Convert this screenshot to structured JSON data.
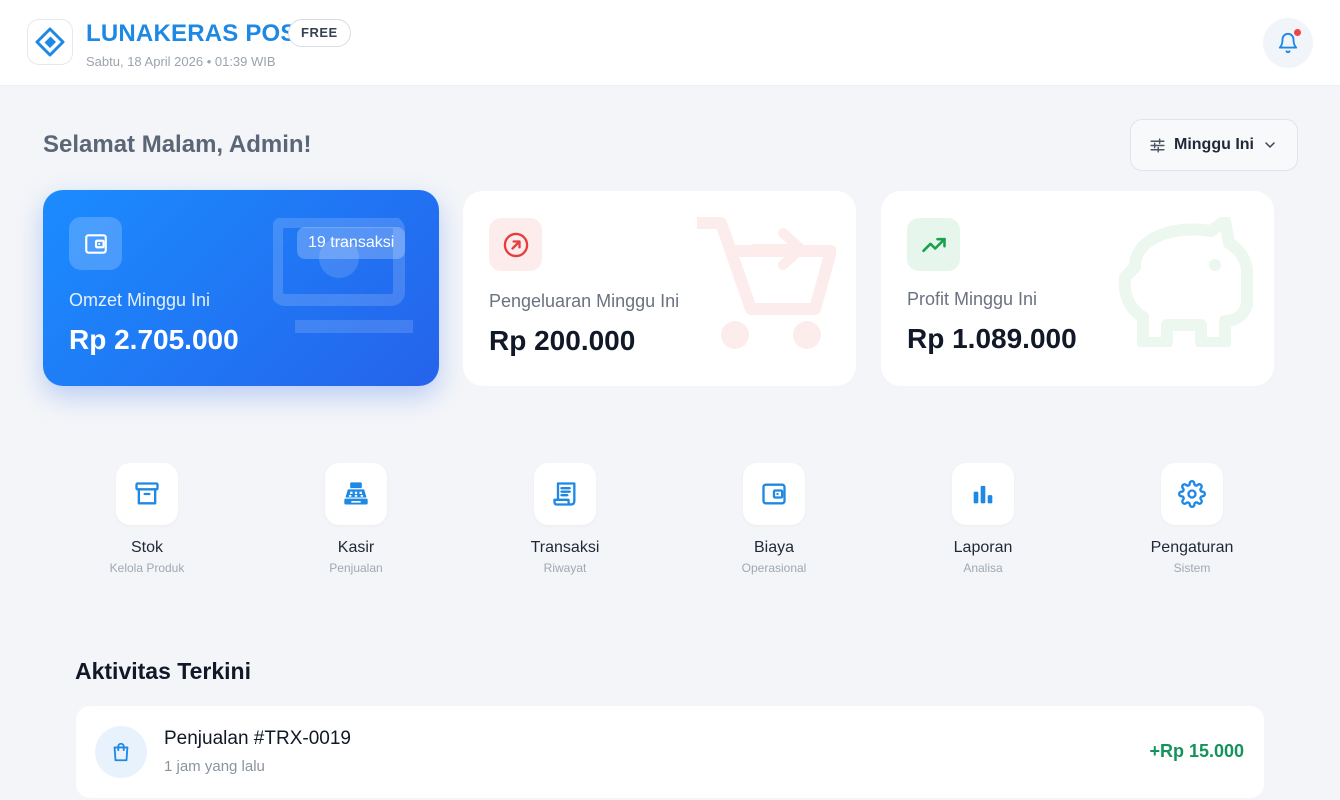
{
  "header": {
    "brand": "LUNAKERAS POS",
    "plan": "FREE",
    "datetime": "Sabtu, 18 April 2026 • 01:39 WIB"
  },
  "greeting": "Selamat Malam, Admin!",
  "period_filter": {
    "label": "Minggu Ini"
  },
  "stats": {
    "omzet": {
      "label": "Omzet Minggu Ini",
      "value": "Rp 2.705.000",
      "badge": "19 transaksi",
      "icon": "wallet-icon"
    },
    "pengeluaran": {
      "label": "Pengeluaran Minggu Ini",
      "value": "Rp 200.000",
      "icon": "arrow-up-right-circle-icon"
    },
    "profit": {
      "label": "Profit Minggu Ini",
      "value": "Rp 1.089.000",
      "icon": "trending-up-icon"
    }
  },
  "menu": [
    {
      "label": "Stok",
      "sub": "Kelola Produk",
      "icon": "archive-box-icon"
    },
    {
      "label": "Kasir",
      "sub": "Penjualan",
      "icon": "cash-register-icon"
    },
    {
      "label": "Transaksi",
      "sub": "Riwayat",
      "icon": "receipt-icon"
    },
    {
      "label": "Biaya",
      "sub": "Operasional",
      "icon": "wallet-icon"
    },
    {
      "label": "Laporan",
      "sub": "Analisa",
      "icon": "bar-chart-icon"
    },
    {
      "label": "Pengaturan",
      "sub": "Sistem",
      "icon": "gear-icon"
    }
  ],
  "activity": {
    "title": "Aktivitas Terkini",
    "items": [
      {
        "title": "Penjualan #TRX-0019",
        "time": "1 jam yang lalu",
        "amount": "+Rp 15.000",
        "icon": "shopping-bag-icon"
      }
    ]
  },
  "colors": {
    "accent": "#1e88e5",
    "omzet_gradient_start": "#1b8cff",
    "omzet_gradient_end": "#2563eb",
    "expense": "#e53e3e",
    "profit": "#16a34a",
    "positive_amount": "#15935c",
    "notification_dot": "#ef4444"
  }
}
